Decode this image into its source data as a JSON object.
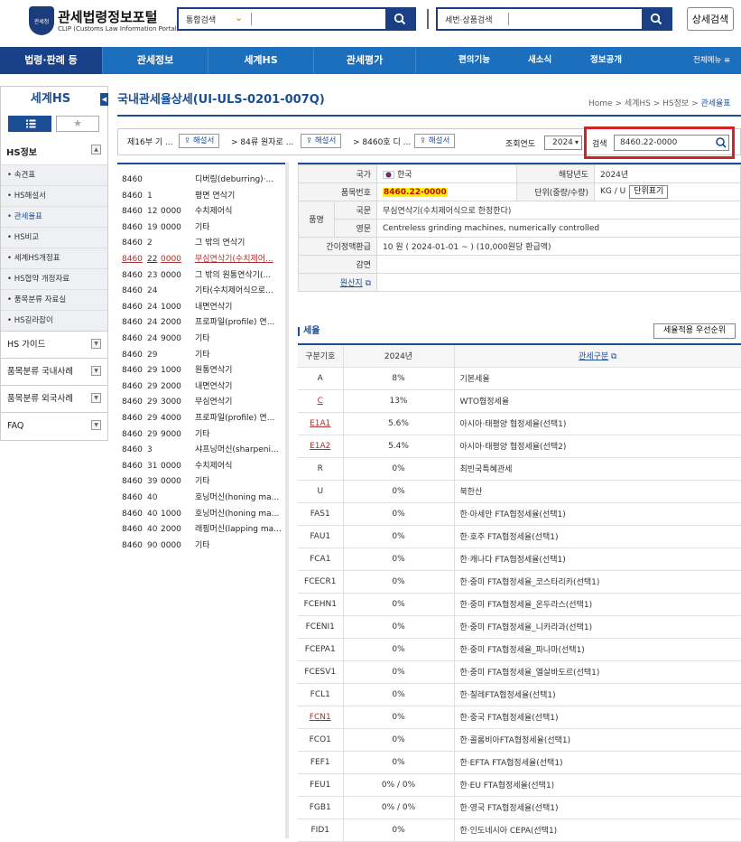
{
  "header": {
    "logo_badge": "관세청",
    "logo_title": "관세법령정보포털",
    "logo_subtitle": "CLIP (Customs Law Information Portal)",
    "search1_select": "통합검색",
    "search2_placeholder": "세번·상품검색",
    "detail_search": "상세검색"
  },
  "nav": {
    "items": [
      "법령·판례 등",
      "관세정보",
      "세계HS",
      "관세평가",
      "편의기능",
      "새소식",
      "정보공개",
      "전체메뉴"
    ]
  },
  "sidebar": {
    "title": "세계HS",
    "section": "HS정보",
    "items": [
      "속견표",
      "HS해설서",
      "관세율표",
      "HS비교",
      "세계HS개정표",
      "HS협약 개정자료",
      "품목분류 자료실",
      "HS길라잡이"
    ],
    "menus": [
      "HS 가이드",
      "품목분류 국내사례",
      "품목분류 외국사례",
      "FAQ"
    ]
  },
  "page": {
    "title": "국내관세율상세(UI-ULS-0201-007Q)",
    "breadcrumb": [
      "Home",
      "세계HS",
      "HS정보",
      "관세율표"
    ]
  },
  "ribbon": {
    "part": "제16부 기 ...",
    "chapter": "84류 원자로 ...",
    "heading": "8460호 디 ...",
    "commentary": "해설서",
    "year_label": "조회연도",
    "year_value": "2024",
    "query_label": "검색",
    "query_value": "8460.22-0000"
  },
  "hs_list": [
    {
      "h": "8460",
      "s": "",
      "c": "",
      "d": "디버링(deburring)·..."
    },
    {
      "h": "8460",
      "s": "1",
      "c": "",
      "d": "평면 연삭기"
    },
    {
      "h": "8460",
      "s": "12",
      "c": "0000",
      "d": "수치제어식"
    },
    {
      "h": "8460",
      "s": "19",
      "c": "0000",
      "d": "기타"
    },
    {
      "h": "8460",
      "s": "2",
      "c": "",
      "d": "그 밖의 연삭기"
    },
    {
      "h": "8460",
      "s": "22",
      "c": "0000",
      "d": "무심연삭기(수치제어..."
    },
    {
      "h": "8460",
      "s": "23",
      "c": "0000",
      "d": "그 밖의 원통연삭기(..."
    },
    {
      "h": "8460",
      "s": "24",
      "c": "",
      "d": "기타(수치제어식으로..."
    },
    {
      "h": "8460",
      "s": "24",
      "c": "1000",
      "d": "내면연삭기"
    },
    {
      "h": "8460",
      "s": "24",
      "c": "2000",
      "d": "프로파일(profile) 연..."
    },
    {
      "h": "8460",
      "s": "24",
      "c": "9000",
      "d": "기타"
    },
    {
      "h": "8460",
      "s": "29",
      "c": "",
      "d": "기타"
    },
    {
      "h": "8460",
      "s": "29",
      "c": "1000",
      "d": "원통연삭기"
    },
    {
      "h": "8460",
      "s": "29",
      "c": "2000",
      "d": "내면연삭기"
    },
    {
      "h": "8460",
      "s": "29",
      "c": "3000",
      "d": "무심연삭기"
    },
    {
      "h": "8460",
      "s": "29",
      "c": "4000",
      "d": "프로파일(profile) 연..."
    },
    {
      "h": "8460",
      "s": "29",
      "c": "9000",
      "d": "기타"
    },
    {
      "h": "8460",
      "s": "3",
      "c": "",
      "d": "샤프닝머신(sharpeni..."
    },
    {
      "h": "8460",
      "s": "31",
      "c": "0000",
      "d": "수치제어식"
    },
    {
      "h": "8460",
      "s": "39",
      "c": "0000",
      "d": "기타"
    },
    {
      "h": "8460",
      "s": "40",
      "c": "",
      "d": "호닝머신(honing ma..."
    },
    {
      "h": "8460",
      "s": "40",
      "c": "1000",
      "d": "호닝머신(honing ma..."
    },
    {
      "h": "8460",
      "s": "40",
      "c": "2000",
      "d": "래핑머신(lapping ma..."
    },
    {
      "h": "8460",
      "s": "90",
      "c": "0000",
      "d": "기타"
    }
  ],
  "info": {
    "country_label": "국가",
    "country_value": "한국",
    "year_label": "해당년도",
    "year_value": "2024년",
    "code_label": "품목번호",
    "code_value": "8460.22-0000",
    "unit_label": "단위(중량/수량)",
    "unit_value": "KG / U",
    "unit_button": "단위표기",
    "name_label": "품명",
    "kor_label": "국문",
    "kor_value": "무심연삭기(수치제어식으로 한정한다)",
    "eng_label": "영문",
    "eng_value": "Centreless grinding machines, numerically controlled",
    "refund_label": "간이정액환급",
    "refund_value": "10 원 ( 2024-01-01 ~ ) (10,000원당 환급액)",
    "reduction_label": "감면",
    "origin_label": "원산지"
  },
  "rates": {
    "title": "세율",
    "priority_button": "세율적용 우선순위",
    "headers": [
      "구분기호",
      "2024년",
      "관세구분"
    ],
    "rows": [
      {
        "k": "A",
        "r": "8%",
        "n": "기본세율"
      },
      {
        "k": "C",
        "r": "13%",
        "n": "WTO협정세율"
      },
      {
        "k": "E1A1",
        "r": "5.6%",
        "n": "아시아·태평양 협정세율(선택1)"
      },
      {
        "k": "E1A2",
        "r": "5.4%",
        "n": "아시아·태평양 협정세율(선택2)"
      },
      {
        "k": "R",
        "r": "0%",
        "n": "최빈국특혜관세"
      },
      {
        "k": "U",
        "r": "0%",
        "n": "북한산"
      },
      {
        "k": "FAS1",
        "r": "0%",
        "n": "한·아세안 FTA협정세율(선택1)"
      },
      {
        "k": "FAU1",
        "r": "0%",
        "n": "한·호주 FTA협정세율(선택1)"
      },
      {
        "k": "FCA1",
        "r": "0%",
        "n": "한·캐나다 FTA협정세율(선택1)"
      },
      {
        "k": "FCECR1",
        "r": "0%",
        "n": "한·중미 FTA협정세율_코스타리카(선택1)"
      },
      {
        "k": "FCEHN1",
        "r": "0%",
        "n": "한·중미 FTA협정세율_온두라스(선택1)"
      },
      {
        "k": "FCENI1",
        "r": "0%",
        "n": "한·중미 FTA협정세율_니카라과(선택1)"
      },
      {
        "k": "FCEPA1",
        "r": "0%",
        "n": "한·중미 FTA협정세율_파나마(선택1)"
      },
      {
        "k": "FCESV1",
        "r": "0%",
        "n": "한·중미 FTA협정세율_엘살바도르(선택1)"
      },
      {
        "k": "FCL1",
        "r": "0%",
        "n": "한·칠레FTA협정세율(선택1)"
      },
      {
        "k": "FCN1",
        "r": "0%",
        "n": "한·중국 FTA협정세율(선택1)"
      },
      {
        "k": "FCO1",
        "r": "0%",
        "n": "한·콜롬비아FTA협정세율(선택1)"
      },
      {
        "k": "FEF1",
        "r": "0%",
        "n": "한·EFTA FTA협정세율(선택1)"
      },
      {
        "k": "FEU1",
        "r": "0% / 0%",
        "n": "한·EU FTA협정세율(선택1)"
      },
      {
        "k": "FGB1",
        "r": "0% / 0%",
        "n": "한·영국 FTA협정세율(선택1)"
      },
      {
        "k": "FID1",
        "r": "0%",
        "n": "한·인도네시아 CEPA(선택1)"
      }
    ]
  }
}
